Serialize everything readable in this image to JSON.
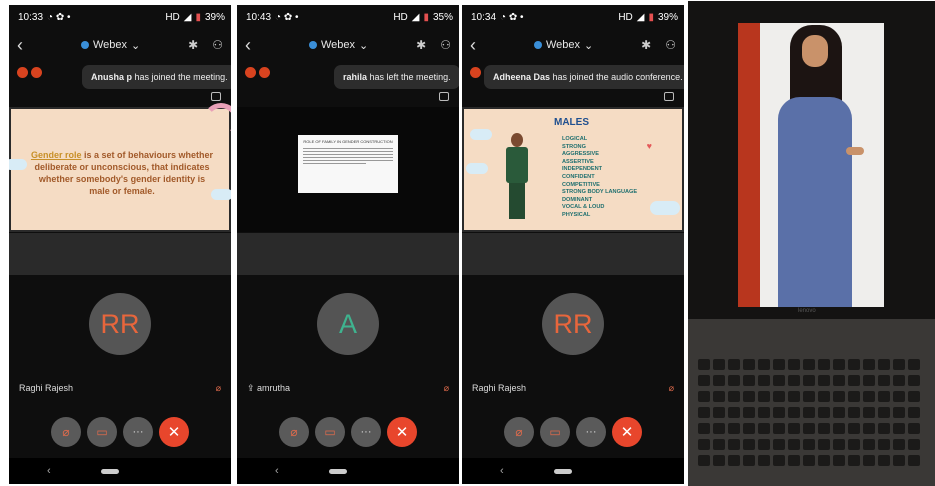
{
  "phones": [
    {
      "status": {
        "time": "10:33",
        "notif_icons": "whatsapp-icon, cloud-icon",
        "battery": "39%",
        "network": "HD"
      },
      "app_title": "Webex",
      "toast": {
        "name": "Anusha p",
        "text": "has joined the meeting."
      },
      "slide": {
        "type": "text-slide",
        "highlight": "Gender role",
        "text": "is a set of behaviours whether deliberate or unconscious, that indicates whether somebody's gender identity is male or female."
      },
      "avatar_initials": "RR",
      "participant_name": "Raghi Rajesh",
      "participant_muted": true,
      "share_indicator": false
    },
    {
      "status": {
        "time": "10:43",
        "notif_icons": "whatsapp-icon, cloud-icon",
        "battery": "35%",
        "network": "HD"
      },
      "app_title": "Webex",
      "toast": {
        "name": "rahila",
        "text": "has left the meeting."
      },
      "slide": {
        "type": "document",
        "doc_title": "ROLE OF FAMILY IN GENDER CONSTRUCTION"
      },
      "avatar_initials": "A",
      "participant_name": "amrutha",
      "participant_muted": true,
      "share_indicator": true
    },
    {
      "status": {
        "time": "10:34",
        "notif_icons": "whatsapp-icon, cloud-icon",
        "battery": "39%",
        "network": "HD"
      },
      "app_title": "Webex",
      "toast": {
        "name": "Adheena Das",
        "text": "has joined the audio conference."
      },
      "slide": {
        "type": "list-slide",
        "title": "MALES",
        "items": [
          "LOGICAL",
          "STRONG",
          "AGGRESSIVE",
          "ASSERTIVE",
          "INDEPENDENT",
          "CONFIDENT",
          "COMPETITIVE",
          "STRONG BODY LANGUAGE",
          "DOMINANT",
          "VOCAL & LOUD",
          "PHYSICAL"
        ]
      },
      "avatar_initials": "RR",
      "participant_name": "Raghi Rajesh",
      "participant_muted": true,
      "share_indicator": false
    }
  ],
  "controls": {
    "mute_icon": "mic-off-icon",
    "video_icon": "video-off-icon",
    "more_label": "···",
    "end_label": "✕"
  },
  "photo": {
    "laptop_brand": "lenovo"
  },
  "colors": {
    "accent_red": "#e8462c",
    "avatar_orange": "#e8663c",
    "avatar_green": "#3fb38f",
    "webex_blue": "#3a8fd8"
  }
}
